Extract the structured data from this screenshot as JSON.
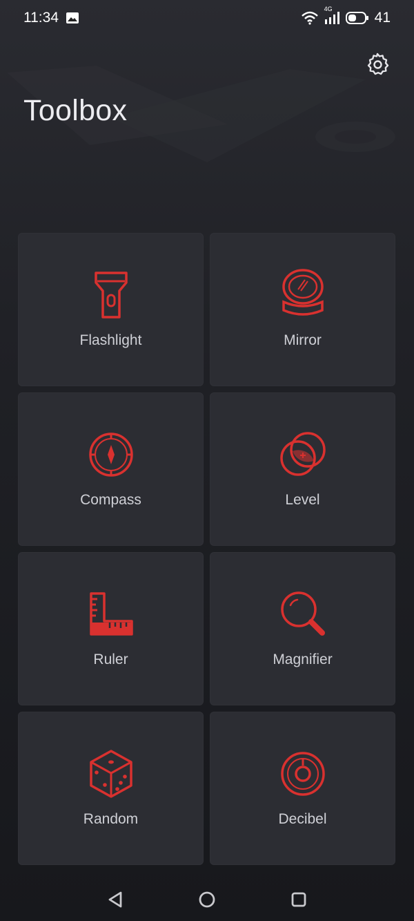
{
  "status": {
    "time": "11:34",
    "network": "4G",
    "battery": "41",
    "icons": [
      "image-notification-icon",
      "wifi-icon",
      "signal-icon",
      "battery-icon"
    ]
  },
  "header": {
    "title": "Toolbox",
    "settings_icon": "gear-icon"
  },
  "accent_color": "#d9312f",
  "tools": [
    {
      "label": "Flashlight",
      "icon": "flashlight-icon"
    },
    {
      "label": "Mirror",
      "icon": "mirror-icon"
    },
    {
      "label": "Compass",
      "icon": "compass-icon"
    },
    {
      "label": "Level",
      "icon": "level-icon"
    },
    {
      "label": "Ruler",
      "icon": "ruler-icon"
    },
    {
      "label": "Magnifier",
      "icon": "magnifier-icon"
    },
    {
      "label": "Random",
      "icon": "dice-icon"
    },
    {
      "label": "Decibel",
      "icon": "decibel-icon"
    }
  ],
  "navigation": {
    "back": "back-triangle-icon",
    "home": "home-circle-icon",
    "recents": "recents-square-icon"
  }
}
